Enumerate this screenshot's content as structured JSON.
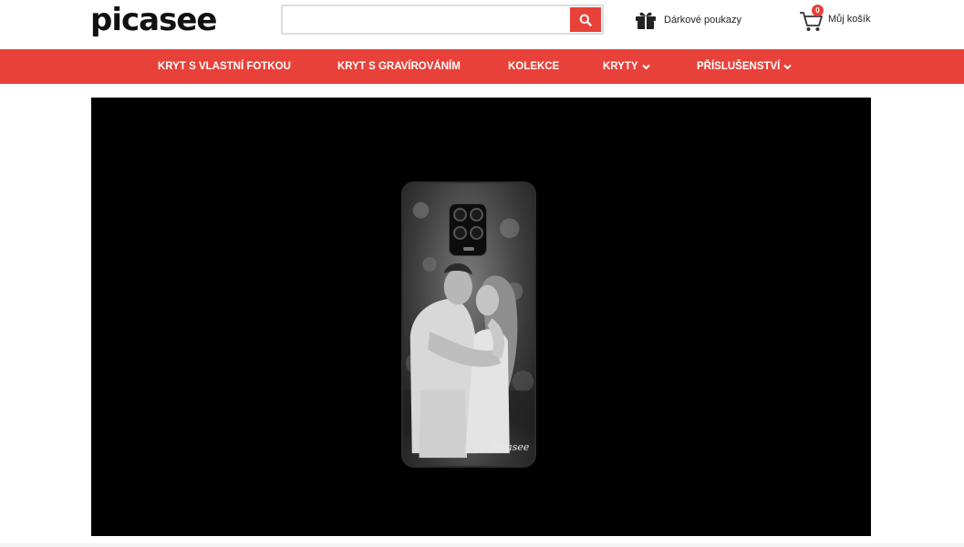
{
  "header": {
    "logo_text": "picasee",
    "search": {
      "value": "",
      "placeholder": ""
    },
    "gift": {
      "label": "Dárkové poukazy",
      "icon": "gift-icon"
    },
    "cart": {
      "label": "Můj košík",
      "count": "0",
      "icon": "cart-icon"
    }
  },
  "nav": {
    "items": [
      {
        "label": "KRYT S VLASTNÍ FOTKOU",
        "has_dropdown": false
      },
      {
        "label": "KRYT S GRAVÍROVÁNÍM",
        "has_dropdown": false
      },
      {
        "label": "KOLEKCE",
        "has_dropdown": false
      },
      {
        "label": "KRYTY",
        "has_dropdown": true
      },
      {
        "label": "PŘÍSLUŠENSTVÍ",
        "has_dropdown": true
      }
    ]
  },
  "hero": {
    "watermark": "Picasee"
  },
  "colors": {
    "brand_red": "#e8413a",
    "hero_bg": "#000000"
  }
}
